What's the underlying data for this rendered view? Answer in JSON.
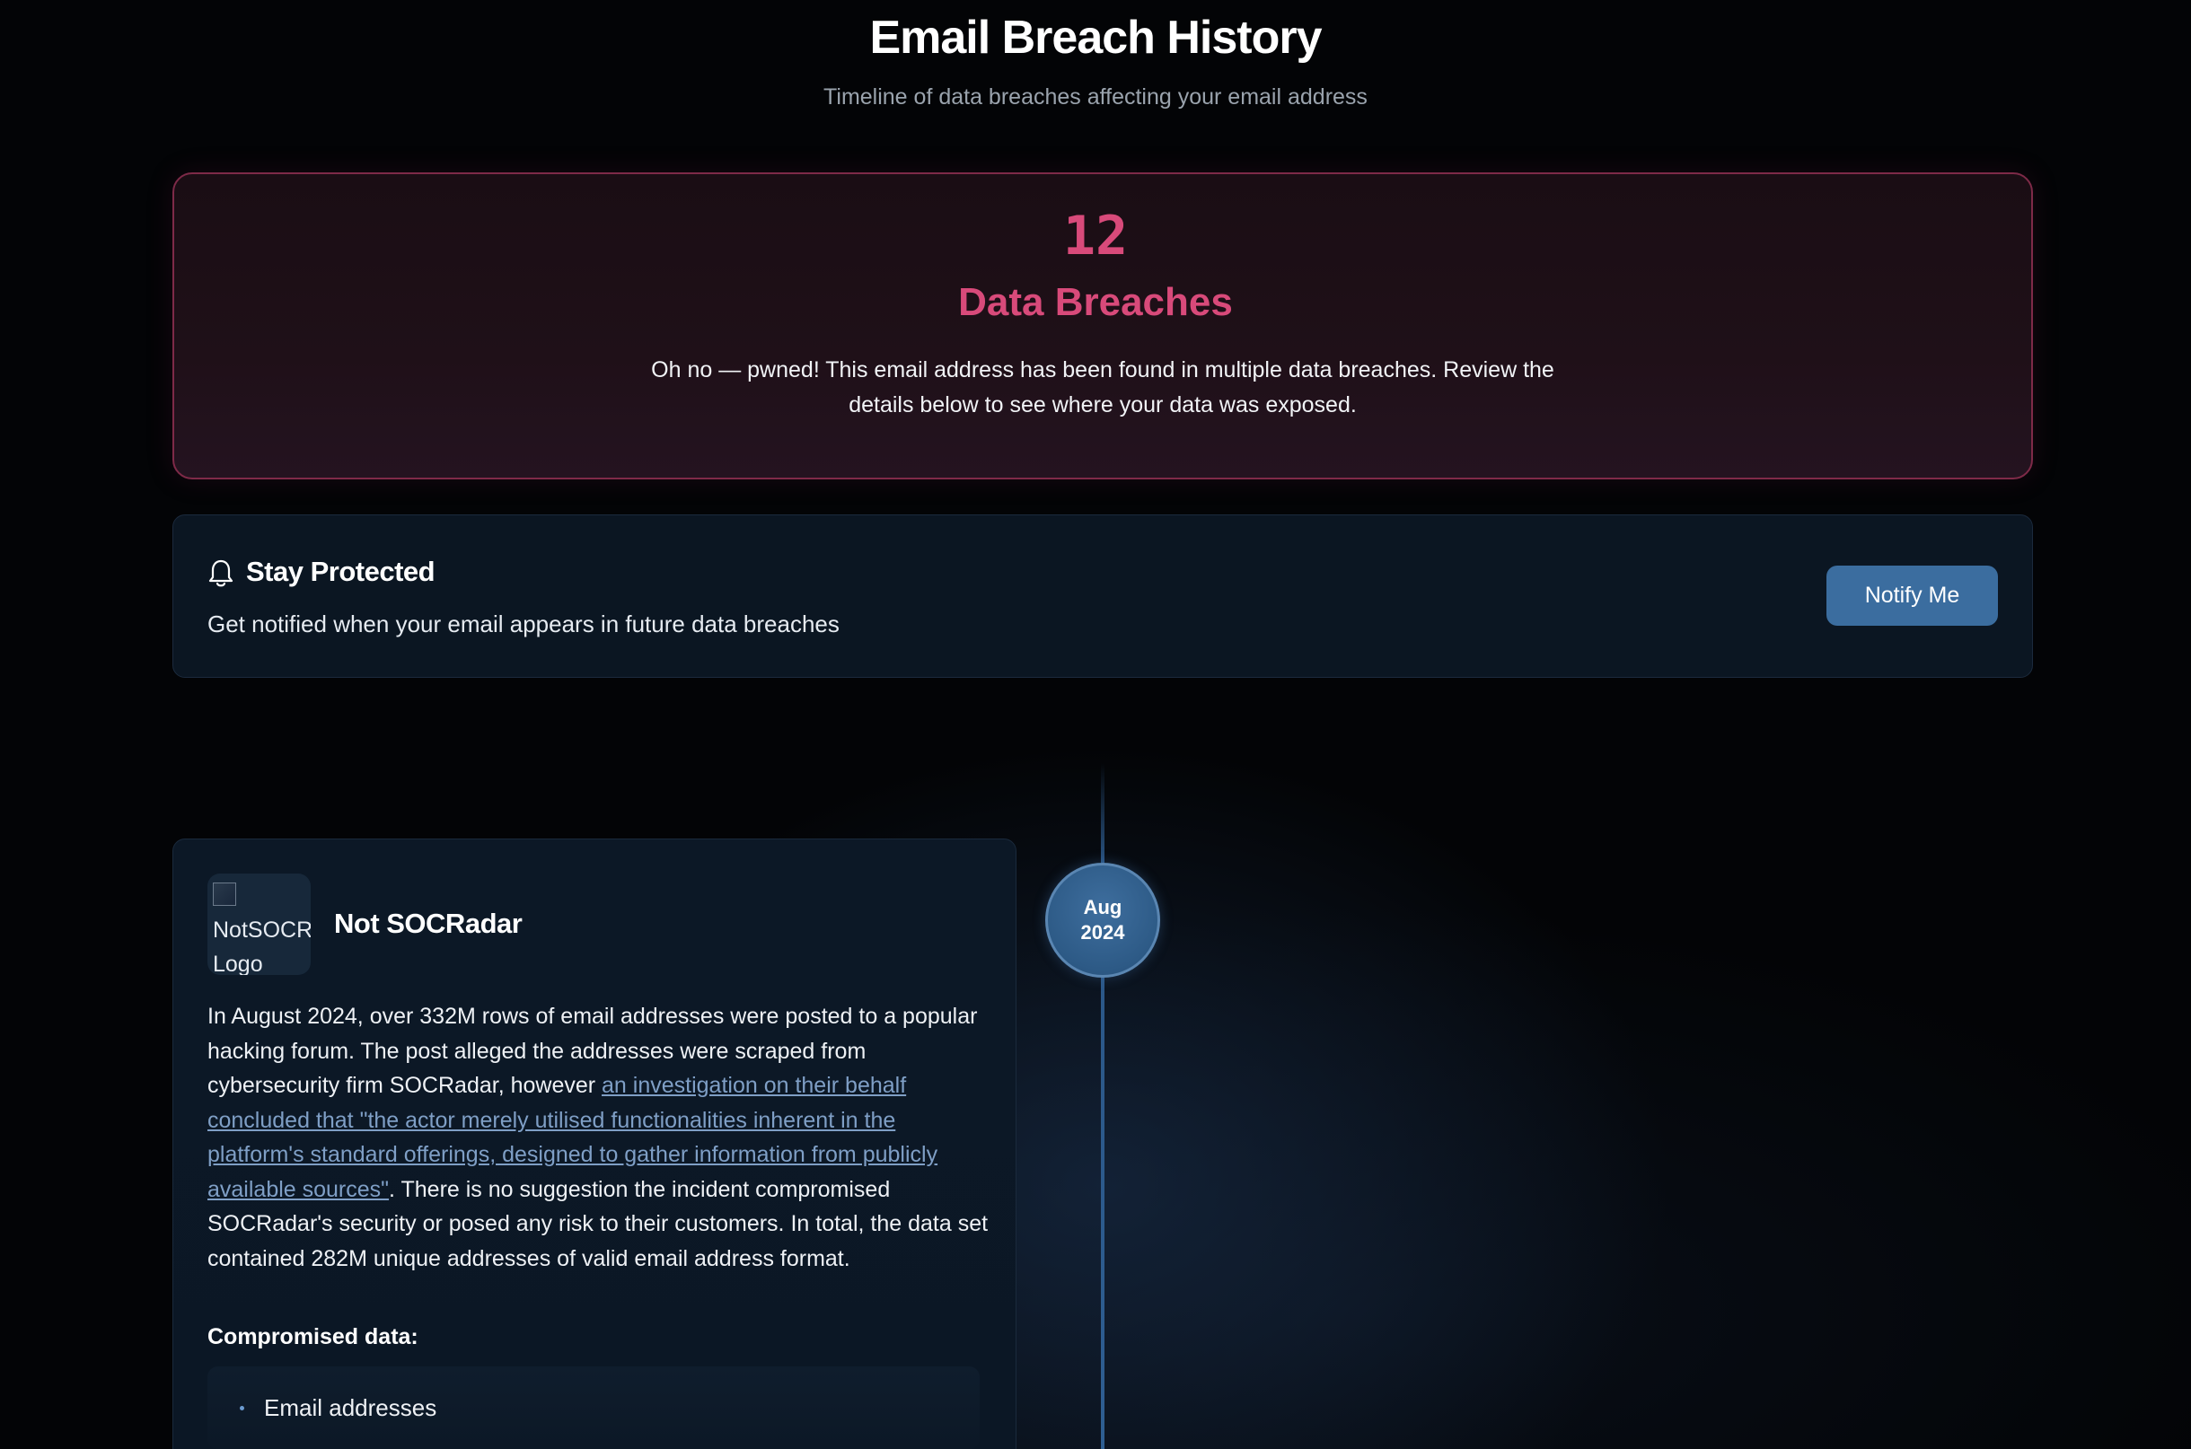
{
  "header": {
    "title": "Email Breach History",
    "subtitle": "Timeline of data breaches affecting your email address"
  },
  "summary": {
    "count": "12",
    "label": "Data Breaches",
    "message": "Oh no — pwned! This email address has been found in multiple data breaches. Review the details below to see where your data was exposed.",
    "accent_color": "#d84a7a"
  },
  "protect": {
    "icon": "bell-icon",
    "title": "Stay Protected",
    "description": "Get notified when your email appears in future data breaches",
    "button_label": "Notify Me",
    "button_color": "#3b6d9f"
  },
  "timeline": {
    "entries": [
      {
        "date_month": "Aug",
        "date_year": "2024",
        "logo_alt": "NotSOCRadar Logo",
        "name": "Not SOCRadar",
        "description_before_link": "In August 2024, over 332M rows of email addresses were posted to a popular hacking forum. The post alleged the addresses were scraped from cybersecurity firm SOCRadar, however ",
        "description_link": "an investigation on their behalf concluded that \"the actor merely utilised functionalities inherent in the platform's standard offerings, designed to gather information from publicly available sources\"",
        "description_after_link": ". There is no suggestion the incident compromised SOCRadar's security or posed any risk to their customers. In total, the data set contained 282M unique addresses of valid email address format.",
        "compromised_label": "Compromised data:",
        "compromised_items": [
          "Email addresses"
        ]
      }
    ]
  }
}
